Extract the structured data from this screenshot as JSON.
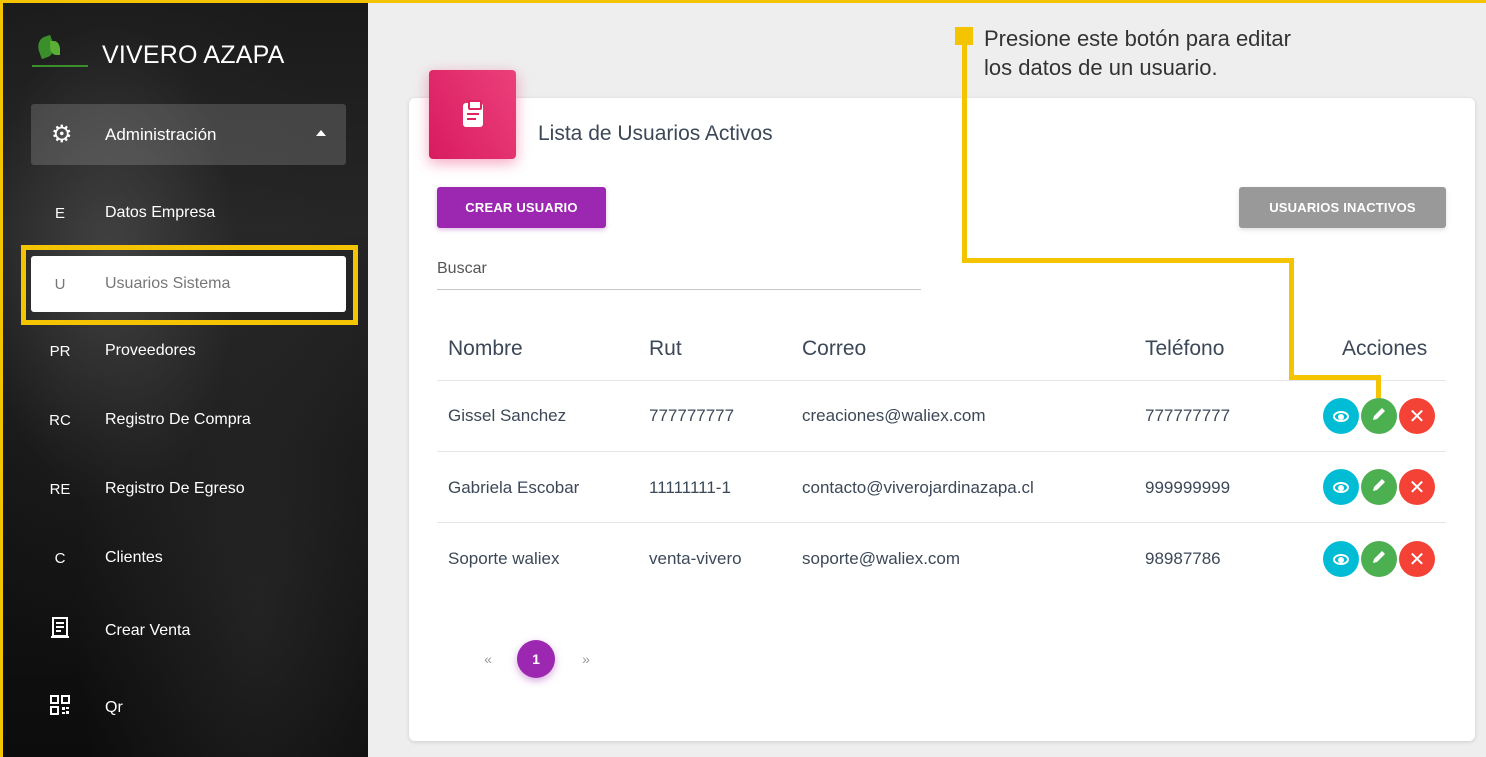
{
  "brand": {
    "name": "VIVERO AZAPA"
  },
  "sidebar": {
    "admin": {
      "label": "Administración"
    },
    "items": [
      {
        "abbr": "E",
        "label": "Datos Empresa"
      },
      {
        "abbr": "U",
        "label": "Usuarios Sistema",
        "active": true
      },
      {
        "abbr": "PR",
        "label": "Proveedores"
      },
      {
        "abbr": "RC",
        "label": "Registro De Compra"
      },
      {
        "abbr": "RE",
        "label": "Registro De Egreso"
      },
      {
        "abbr": "C",
        "label": "Clientes"
      }
    ],
    "icon_items": [
      {
        "icon": "receipt-icon",
        "label": "Crear Venta"
      },
      {
        "icon": "qr-code-icon",
        "label": "Qr"
      }
    ]
  },
  "card": {
    "title": "Lista de Usuarios Activos",
    "create_button": "CREAR USUARIO",
    "inactive_button": "USUARIOS INACTIVOS",
    "search_placeholder": "Buscar"
  },
  "table": {
    "headers": [
      "Nombre",
      "Rut",
      "Correo",
      "Teléfono",
      "Acciones"
    ],
    "rows": [
      {
        "nombre": "Gissel Sanchez",
        "rut": "777777777",
        "correo": "creaciones@waliex.com",
        "telefono": "777777777"
      },
      {
        "nombre": "Gabriela Escobar",
        "rut": "11111111-1",
        "correo": "contacto@viverojardinazapa.cl",
        "telefono": "999999999"
      },
      {
        "nombre": "Soporte waliex",
        "rut": "venta-vivero",
        "correo": "soporte@waliex.com",
        "telefono": "98987786"
      }
    ]
  },
  "pagination": {
    "prev": "«",
    "current": "1",
    "next": "»"
  },
  "annotation": {
    "line1": "Presione este botón para editar",
    "line2": "los datos de un usuario."
  },
  "colors": {
    "accent": "#9c27b0",
    "card_icon": "#e91e63",
    "highlight": "#f5c400",
    "view": "#00bcd4",
    "edit": "#4caf50",
    "delete": "#f44336",
    "inactive": "#999999"
  }
}
